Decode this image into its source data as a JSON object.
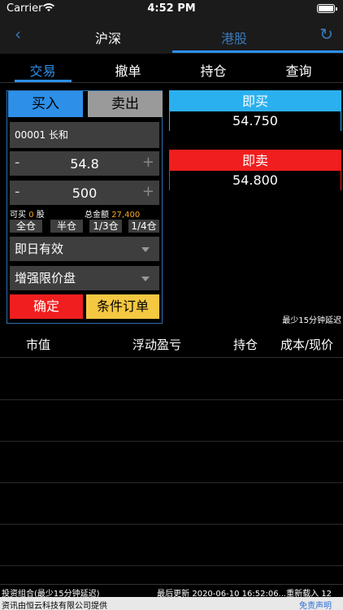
{
  "status": {
    "carrier": "Carrier",
    "time": "4:52 PM"
  },
  "nav": {
    "tab_hs": "沪深",
    "tab_gg": "港股"
  },
  "tabs": [
    {
      "label": "交易"
    },
    {
      "label": "撤单"
    },
    {
      "label": "持仓"
    },
    {
      "label": "查询"
    }
  ],
  "order": {
    "buy_label": "买入",
    "sell_label": "卖出",
    "stock": "00001 长和",
    "price": "54.8",
    "quantity": "500",
    "minus": "-",
    "plus": "+",
    "can_buy_label": "可买",
    "can_buy_value": "0",
    "can_buy_unit": "股",
    "total_label": "总金额",
    "total_value": "27,400",
    "qty_options": [
      "全仓",
      "半仓",
      "1/3仓",
      "1/4仓"
    ],
    "validity": "即日有效",
    "order_type": "增强限价盘",
    "confirm_label": "确定",
    "conditional_label": "条件订单"
  },
  "quotes": {
    "buy_label": "即买",
    "buy_price": "54.750",
    "sell_label": "即卖",
    "sell_price": "54.800"
  },
  "delay_note": "最少15分钟延迟",
  "holdings": {
    "columns": [
      "市值",
      "浮动盈亏",
      "持仓",
      "成本/现价"
    ]
  },
  "footer": {
    "portfolio": "投资组合(最少15分钟延迟)",
    "updated": "最后更新 2020-06-10 16:52:06...重新载入 12",
    "provider": "资讯由恒云科技有限公司提供",
    "disclaimer": "免责声明"
  },
  "colors": {
    "accent": "#2d8fe8",
    "buy": "#2bb0ef",
    "sell": "#f01e1e",
    "conditional": "#f5c842",
    "amount": "#f5a623"
  }
}
